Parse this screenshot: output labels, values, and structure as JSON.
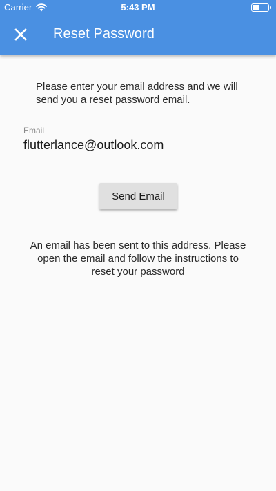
{
  "status_bar": {
    "carrier": "Carrier",
    "time": "5:43 PM",
    "wifi_icon": "wifi-icon",
    "battery_icon": "battery-icon",
    "battery_level": 0.4
  },
  "app_bar": {
    "title": "Reset Password",
    "close_icon": "close-icon",
    "background_color": "#4a90e2"
  },
  "instruction": "Please enter your email address and we will send you a reset password email.",
  "email_field": {
    "label": "Email",
    "value": "flutterlance@outlook.com"
  },
  "send_button": {
    "label": "Send Email"
  },
  "confirmation_message": "An email has been sent to this address. Please open the email and follow the instructions to reset your password"
}
